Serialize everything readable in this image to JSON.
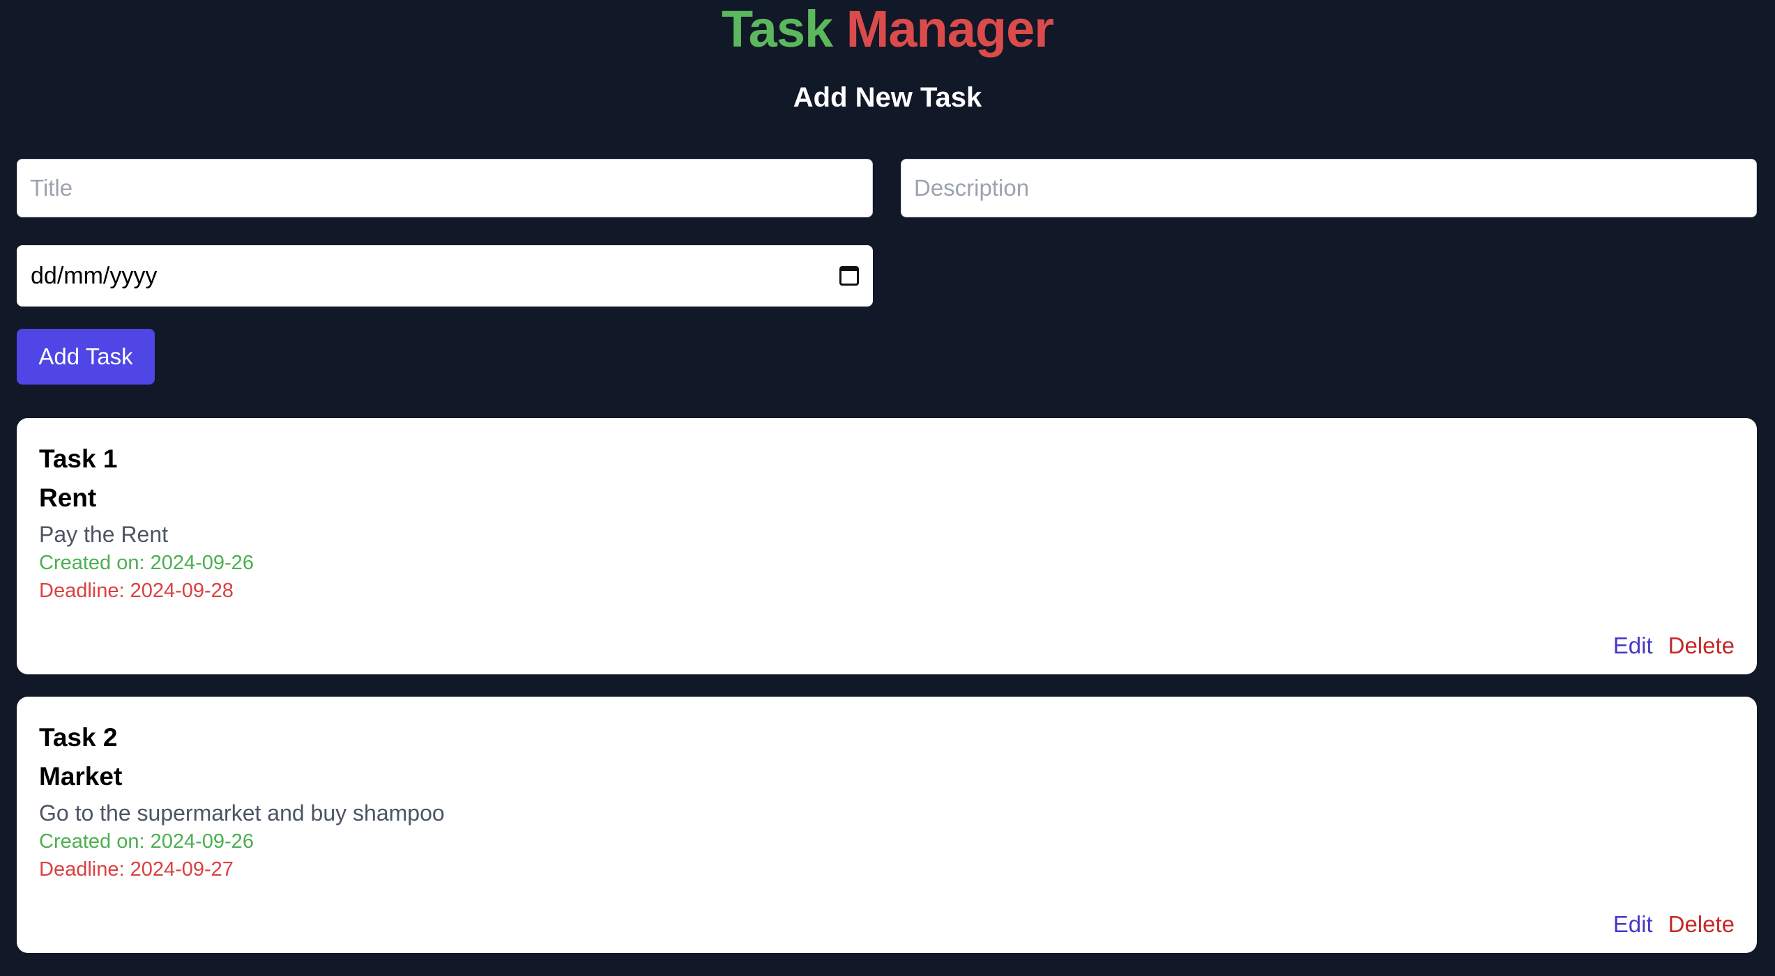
{
  "header": {
    "title_part1": "Task",
    "title_part2": "Manager",
    "subtitle": "Add New Task"
  },
  "form": {
    "title_placeholder": "Title",
    "description_placeholder": "Description",
    "date_value": "dd/mm/yyyy",
    "add_button_label": "Add Task"
  },
  "tasks": [
    {
      "number": "Task 1",
      "title": "Rent",
      "description": "Pay the Rent",
      "created": "Created on: 2024-09-26",
      "deadline": "Deadline: 2024-09-28",
      "edit_label": "Edit",
      "delete_label": "Delete"
    },
    {
      "number": "Task 2",
      "title": "Market",
      "description": "Go to the supermarket and buy shampoo",
      "created": "Created on: 2024-09-26",
      "deadline": "Deadline: 2024-09-27",
      "edit_label": "Edit",
      "delete_label": "Delete"
    }
  ],
  "colors": {
    "background": "#111827",
    "title_green": "#5cb85c",
    "title_red": "#dc4b4b",
    "button": "#4f46e5",
    "created_green": "#4caf50",
    "deadline_red": "#dc4040"
  },
  "icons": {
    "date_picker": "calendar-icon"
  }
}
